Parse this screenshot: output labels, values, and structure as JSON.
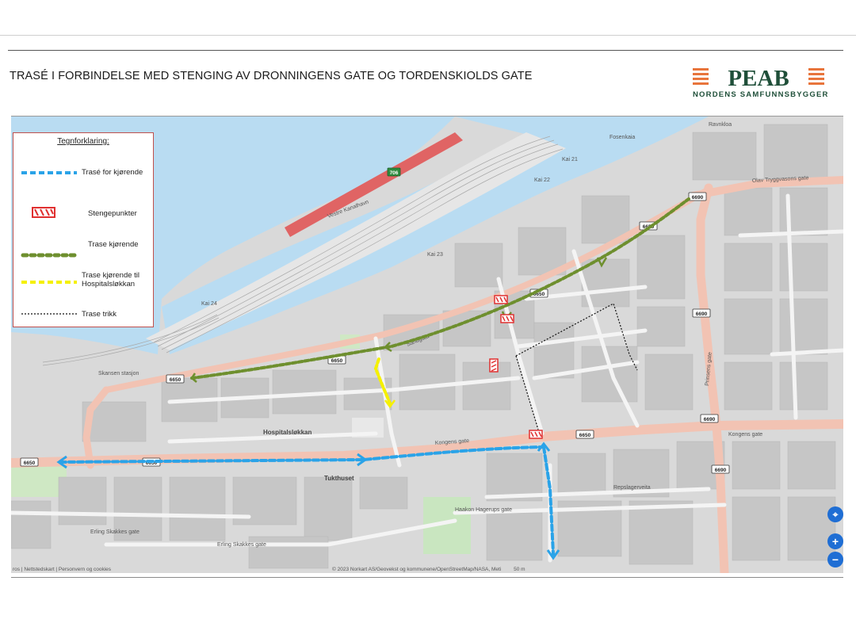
{
  "slide": {
    "title": "TRASÉ I FORBINDELSE MED STENGING AV DRONNINGENS GATE OG TORDENSKIOLDS GATE"
  },
  "logo": {
    "name": "PEAB",
    "tagline": "NORDENS SAMFUNNSBYGGER",
    "colors": {
      "brand_green": "#1f4f39",
      "brand_orange": "#e8743b"
    }
  },
  "legend": {
    "title": "Tegnforklaring:",
    "items": [
      {
        "label": "Trasé for kjørende",
        "style": "dashed",
        "color": "#2aa3e8"
      },
      {
        "label": "Stengepunkter",
        "style": "barrier",
        "color": "#e03030"
      },
      {
        "label": "Trase kjørende",
        "style": "dotted-thick",
        "color": "#6e8f2e"
      },
      {
        "label": "Trase kjørende til Hospitalsløkkan",
        "style": "dashed",
        "color": "#f5f000"
      },
      {
        "label": "Trase trikk",
        "style": "dotted-thin",
        "color": "#111111"
      }
    ]
  },
  "map": {
    "labels": {
      "hospitalslokkan": "Hospitalsløkkan",
      "tukthuset": "Tukthuset",
      "kongens_gate": "Kongens gate",
      "kongens_gate2": "Kongens gate",
      "erling_skakkes": "Erling Skakkes gate",
      "erling_skakkes2": "Erling Skakkes gate",
      "olav_tryggvasons": "Olav Tryggvasons gate",
      "prinsens_gate": "Prinsens gate",
      "haakon_hagerups": "Haakon Hagerups gate",
      "repslagerveita": "Repslagerveita",
      "skansen_stasjon": "Skansen stasjon",
      "vestre_kanalhavn": "Vestre Kanalhavn",
      "sandgata": "Sandgata",
      "kai_21": "Kai 21",
      "kai_22": "Kai 22",
      "kai_23": "Kai 23",
      "kai_24": "Kai 24",
      "ravnkloa": "Ravnkloa",
      "fosenkaia": "Fosenkaia"
    },
    "shields": [
      "6650",
      "6650",
      "6650",
      "6650",
      "6650",
      "6650",
      "6650",
      "6690",
      "6690",
      "6690",
      "6690",
      "706"
    ],
    "footer_left": "ros | Nettstedskart | Personvern og cookies",
    "footer_right": "© 2023 Norkart AS/Geovekst og kommunene/OpenStreetMap/NASA, Meti",
    "scale": "50 m",
    "controls": {
      "locate": "⌖",
      "zoom_in": "+",
      "zoom_out": "−"
    }
  }
}
